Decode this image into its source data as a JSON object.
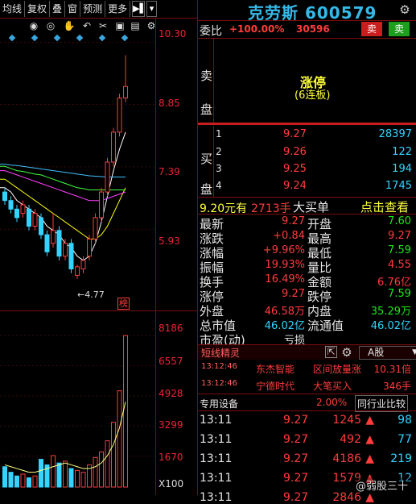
{
  "toolbar": {
    "items": [
      "均线",
      "复权",
      "叠",
      "窗",
      "预测",
      "更多"
    ],
    "arrow_label": "▶▌",
    "dropdown_label": "▾"
  },
  "chart_icons": [
    "eye-icon",
    "eye-outline-icon",
    "hand-icon",
    "undo-icon",
    "scissors-icon",
    "lock-icon",
    "trash-icon",
    "settings-icon"
  ],
  "price_axis": [
    "10.30",
    "8.85",
    "7.39",
    "5.93"
  ],
  "volume_axis": [
    "8186",
    "6557",
    "4928",
    "3299",
    "1670",
    "X100"
  ],
  "low_annotation": "←4.77",
  "rank_badge": "榜",
  "chart_data": [
    {
      "type": "candlestick",
      "title": "",
      "y_ticks": [
        10.3,
        8.85,
        7.39,
        5.93
      ],
      "ylim": [
        4.5,
        10.5
      ],
      "annotation": "←4.77",
      "candles": [
        {
          "o": 6.8,
          "c": 6.6,
          "h": 6.9,
          "l": 6.5
        },
        {
          "o": 6.6,
          "c": 6.4,
          "h": 6.7,
          "l": 6.3
        },
        {
          "o": 6.4,
          "c": 6.2,
          "h": 6.5,
          "l": 6.1
        },
        {
          "o": 6.3,
          "c": 6.5,
          "h": 6.6,
          "l": 6.2
        },
        {
          "o": 6.4,
          "c": 6.0,
          "h": 6.5,
          "l": 5.9
        },
        {
          "o": 6.0,
          "c": 6.3,
          "h": 6.4,
          "l": 5.9
        },
        {
          "o": 6.2,
          "c": 5.8,
          "h": 6.3,
          "l": 5.7
        },
        {
          "o": 5.8,
          "c": 5.4,
          "h": 5.9,
          "l": 5.3
        },
        {
          "o": 5.6,
          "c": 5.9,
          "h": 6.3,
          "l": 5.5
        },
        {
          "o": 5.9,
          "c": 5.3,
          "h": 6.0,
          "l": 5.2
        },
        {
          "o": 5.3,
          "c": 5.6,
          "h": 5.7,
          "l": 5.2
        },
        {
          "o": 5.6,
          "c": 5.0,
          "h": 5.7,
          "l": 4.9
        },
        {
          "o": 4.85,
          "c": 5.05,
          "h": 5.1,
          "l": 4.77
        },
        {
          "o": 5.0,
          "c": 5.2,
          "h": 5.3,
          "l": 4.9
        },
        {
          "o": 5.3,
          "c": 5.7,
          "h": 5.8,
          "l": 5.2
        },
        {
          "o": 5.7,
          "c": 6.2,
          "h": 6.3,
          "l": 5.6
        },
        {
          "o": 6.2,
          "c": 6.8,
          "h": 6.9,
          "l": 6.1
        },
        {
          "o": 6.8,
          "c": 7.5,
          "h": 7.6,
          "l": 6.7
        },
        {
          "o": 7.5,
          "c": 8.2,
          "h": 8.3,
          "l": 7.4
        },
        {
          "o": 8.2,
          "c": 9.0,
          "h": 9.1,
          "l": 8.1
        },
        {
          "o": 9.0,
          "c": 9.27,
          "h": 10.0,
          "l": 8.9
        }
      ],
      "ma_series": [
        {
          "color": "#ffffff",
          "values": [
            6.9,
            6.8,
            6.6,
            6.5,
            6.4,
            6.3,
            6.2,
            6.0,
            5.9,
            5.8,
            5.6,
            5.5,
            5.3,
            5.2,
            5.3,
            5.6,
            6.1,
            6.7,
            7.3,
            7.8,
            8.2
          ]
        },
        {
          "color": "#ffff00",
          "values": [
            7.1,
            7.0,
            6.9,
            6.8,
            6.7,
            6.6,
            6.5,
            6.4,
            6.3,
            6.2,
            6.1,
            6.0,
            5.9,
            5.8,
            5.7,
            5.7,
            5.8,
            6.0,
            6.3,
            6.6,
            6.9
          ]
        },
        {
          "color": "#ff40ff",
          "values": [
            7.3,
            7.25,
            7.2,
            7.15,
            7.1,
            7.05,
            7.0,
            6.95,
            6.9,
            6.85,
            6.8,
            6.75,
            6.7,
            6.65,
            6.6,
            6.6,
            6.6,
            6.65,
            6.7,
            6.75,
            6.8
          ]
        },
        {
          "color": "#40ff40",
          "values": [
            7.4,
            7.35,
            7.3,
            7.28,
            7.25,
            7.22,
            7.2,
            7.15,
            7.1,
            7.05,
            7.0,
            6.95,
            6.9,
            6.88,
            6.85,
            6.85,
            6.85,
            6.85,
            6.85,
            6.85,
            6.85
          ]
        },
        {
          "color": "#40c0ff",
          "values": [
            7.45,
            7.43,
            7.42,
            7.4,
            7.38,
            7.36,
            7.34,
            7.32,
            7.3,
            7.28,
            7.26,
            7.24,
            7.22,
            7.2,
            7.18,
            7.17,
            7.16,
            7.15,
            7.15,
            7.15,
            7.15
          ]
        }
      ]
    },
    {
      "type": "bar",
      "title": "",
      "y_ticks": [
        8186,
        6557,
        4928,
        3299,
        1670
      ],
      "ylim": [
        0,
        8800
      ],
      "unit": "X100",
      "values": [
        1100,
        800,
        600,
        700,
        500,
        600,
        1500,
        1200,
        1700,
        1300,
        1400,
        1000,
        900,
        800,
        1200,
        1600,
        1900,
        2500,
        3500,
        5200,
        8186
      ],
      "colors": [
        "cyan",
        "cyan",
        "cyan",
        "red",
        "cyan",
        "red",
        "cyan",
        "cyan",
        "red",
        "cyan",
        "red",
        "cyan",
        "red",
        "red",
        "red",
        "red",
        "red",
        "red",
        "red",
        "red",
        "red"
      ],
      "ma_values": [
        1200,
        1100,
        1000,
        900,
        800,
        800,
        900,
        1000,
        1100,
        1200,
        1300,
        1200,
        1100,
        1000,
        1000,
        1100,
        1300,
        1700,
        2300,
        3200,
        4600
      ]
    }
  ],
  "stock": {
    "name": "克劳斯 600579"
  },
  "weibi": {
    "label": "委比",
    "value": "+100.00%",
    "volume": "30596",
    "sell_btn": "卖",
    "buy_btn": "卖"
  },
  "sell_side": {
    "label": "卖盘",
    "status": "涨停",
    "note": "(6连板)"
  },
  "buy_side": {
    "label": "买盘",
    "rows": [
      {
        "lv": "1",
        "price": "9.27",
        "vol": "28397"
      },
      {
        "lv": "2",
        "price": "9.26",
        "vol": "122"
      },
      {
        "lv": "3",
        "price": "9.25",
        "vol": "194"
      },
      {
        "lv": "4",
        "price": "9.24",
        "vol": "1745"
      }
    ]
  },
  "big_order": {
    "price": "9.20元有",
    "lots": "2713手",
    "desc": "大买单",
    "link": "点击查看"
  },
  "quote": [
    {
      "l": "最新",
      "v": "9.27",
      "l2": "开盘",
      "v2": "7.60",
      "c": "red",
      "c2": "grn"
    },
    {
      "l": "涨跌",
      "v": "+0.84",
      "l2": "最高",
      "v2": "9.27",
      "c": "red",
      "c2": "red"
    },
    {
      "l": "涨幅",
      "v": "+9.96%",
      "l2": "最低",
      "v2": "7.59",
      "c": "red",
      "c2": "grn"
    },
    {
      "l": "振幅",
      "v": "19.93%",
      "l2": "量比",
      "v2": "4.55",
      "c": "red",
      "c2": "red"
    },
    {
      "l": "换手",
      "v": "16.49%",
      "l2": "金额",
      "v2": "6.76亿",
      "c": "red",
      "c2": "red"
    },
    {
      "l": "涨停",
      "v": "9.27",
      "l2": "跌停",
      "v2": "7.59",
      "c": "red",
      "c2": "grn"
    },
    {
      "l": "外盘",
      "v": "46.58万",
      "l2": "内盘",
      "v2": "35.29万",
      "c": "red",
      "c2": "grn"
    },
    {
      "l": "总市值",
      "v": "46.02亿",
      "l2": "流通值",
      "v2": "46.02亿",
      "c": "cyn",
      "c2": "cyn"
    },
    {
      "l": "市盈(动)",
      "v": "亏损",
      "l2": "",
      "v2": "",
      "c": "wht",
      "c2": "wht"
    }
  ],
  "sprite": {
    "title": "短线精灵",
    "market": "A股",
    "rows": [
      {
        "time": "13:12:46",
        "stock": "东杰智能",
        "event": "区间放量涨",
        "val": "10.31倍"
      },
      {
        "time": "13:12:46",
        "stock": "宁德时代",
        "event": "大笔买入",
        "val": "346手"
      }
    ]
  },
  "special": {
    "label": "专用设备",
    "pct": "2.00%",
    "compare": "同行业比较"
  },
  "ticks": [
    {
      "time": "13:11",
      "price": "9.27",
      "vol": "1245",
      "n": "98"
    },
    {
      "time": "13:11",
      "price": "9.27",
      "vol": "492",
      "n": "77"
    },
    {
      "time": "13:11",
      "price": "9.27",
      "vol": "4186",
      "n": "219"
    },
    {
      "time": "13:11",
      "price": "9.27",
      "vol": "1579",
      "n": "12"
    },
    {
      "time": "13:11",
      "price": "9.27",
      "vol": "2846",
      "n": ""
    }
  ],
  "watermark": "@弱股三十",
  "colors": {
    "up": "#ff3c3c",
    "down": "#35d3ff",
    "accent": "#35b9e8"
  }
}
